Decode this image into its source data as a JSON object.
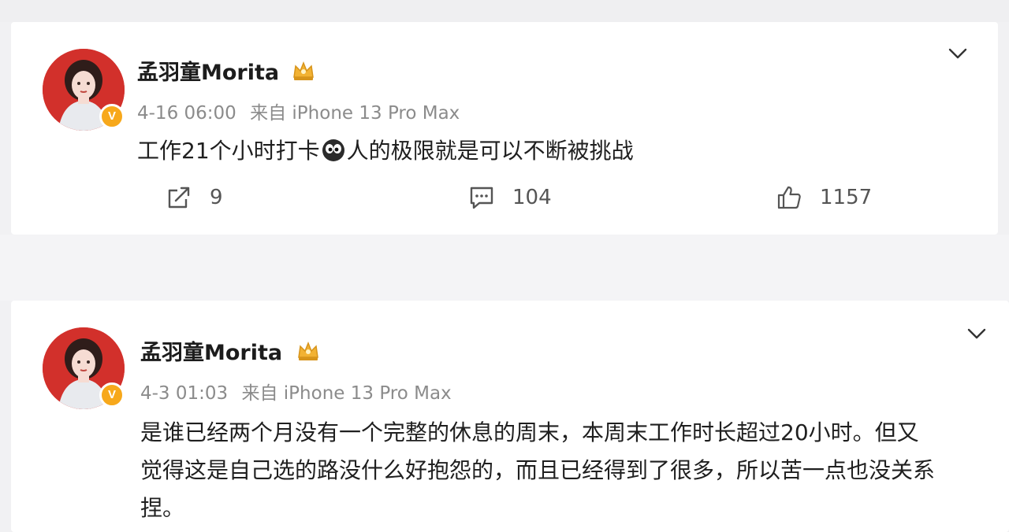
{
  "posts": [
    {
      "username": "孟羽童Morita",
      "time": "4-16 06:00",
      "source": "来自 iPhone 13 Pro Max",
      "content_before_emoji": "工作21个小时打卡",
      "content_after_emoji": "人的极限就是可以不断被挑战",
      "emoji": "eyes-emoji",
      "actions": {
        "repost_count": "9",
        "comment_count": "104",
        "like_count": "1157"
      },
      "verified_badge": "V"
    },
    {
      "username": "孟羽童Morita",
      "time": "4-3 01:03",
      "source": "来自 iPhone 13 Pro Max",
      "content_lines": [
        "是谁已经两个月没有一个完整的休息的周末，本周末工作时长超过20小时。但又",
        "觉得这是自己选的路没什么好抱怨的，而且已经得到了很多，所以苦一点也没关系",
        "捏。"
      ],
      "verified_badge": "V"
    }
  ],
  "colors": {
    "background": "#f1f1f3",
    "card": "#ffffff",
    "text": "#1f1f1f",
    "meta": "#8b8b8b",
    "badge": "#f7a81b",
    "crown": "#f2b233"
  },
  "icons": [
    "chevron-down-icon",
    "repost-icon",
    "comment-icon",
    "like-icon",
    "crown-badge-icon",
    "verified-icon"
  ]
}
